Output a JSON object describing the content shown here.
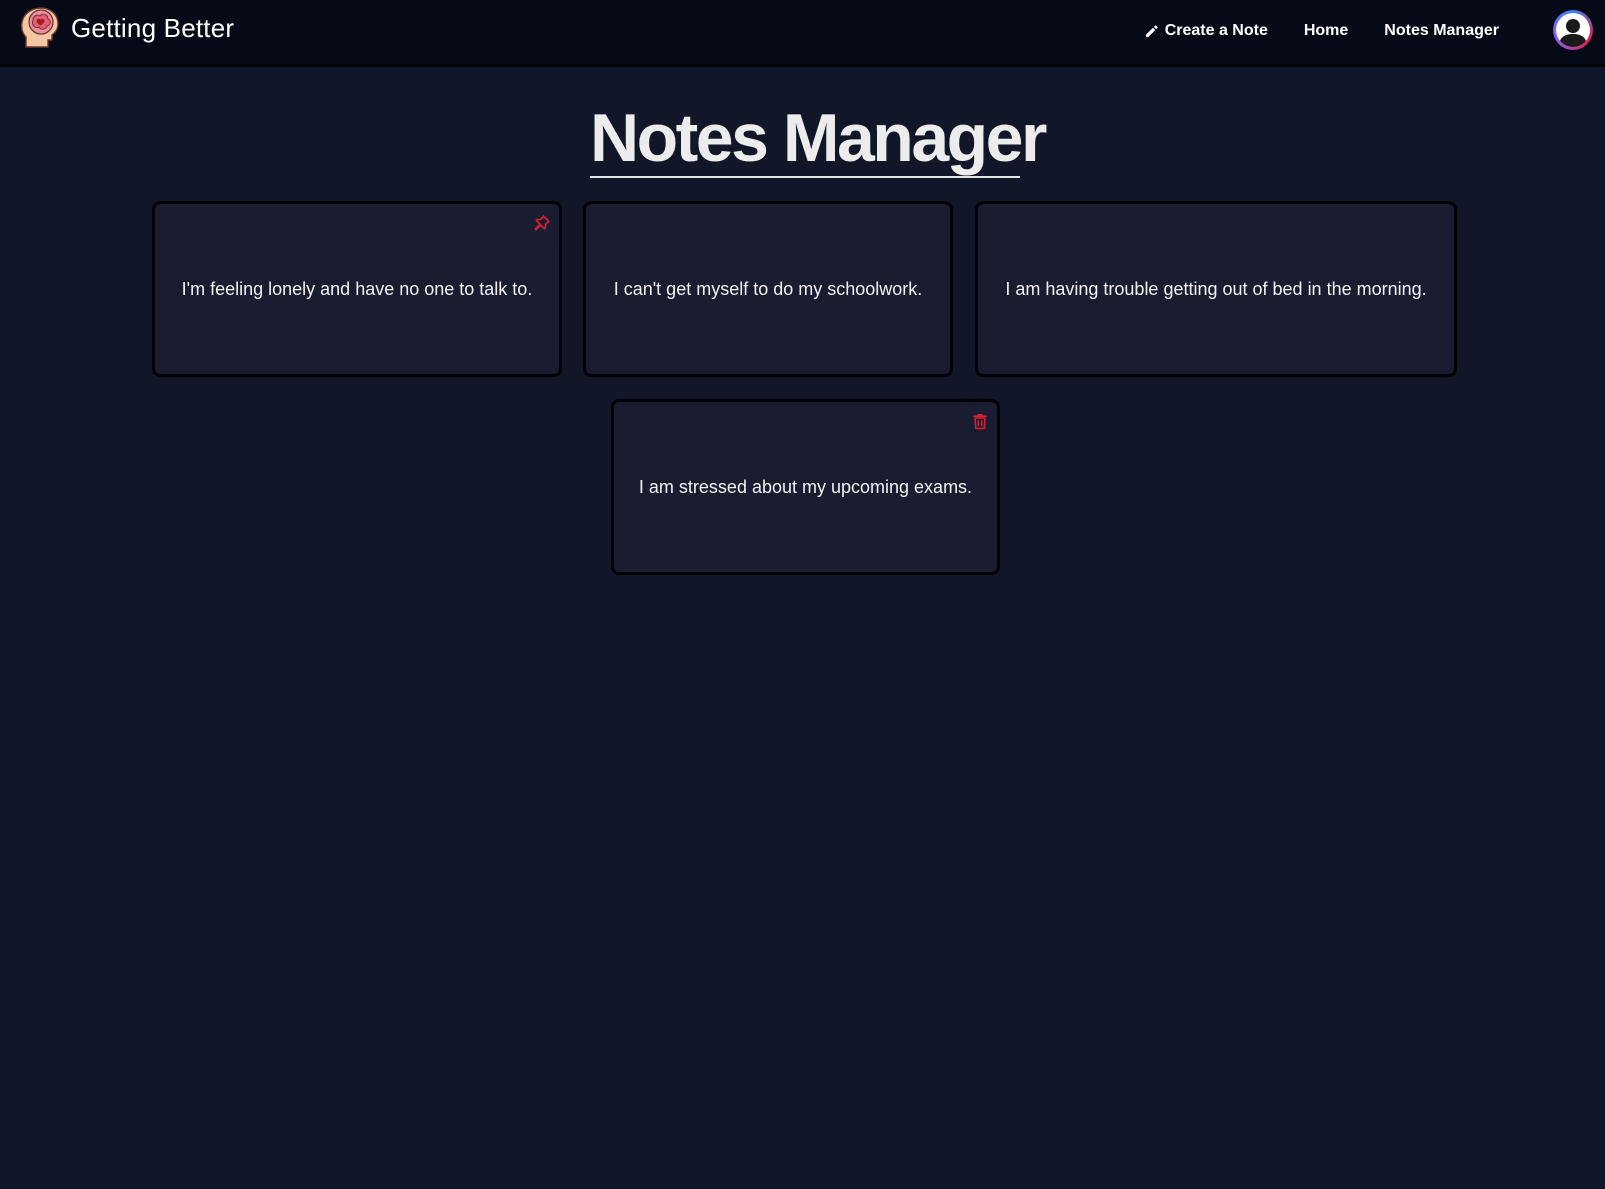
{
  "navbar": {
    "brand_title": "Getting Better",
    "links": [
      {
        "label": "Create a Note",
        "icon": "pencil-icon"
      },
      {
        "label": "Home"
      },
      {
        "label": "Notes Manager"
      }
    ],
    "avatar_icon": "user-avatar-icon"
  },
  "main": {
    "title": "Notes Manager",
    "notes": [
      {
        "text": "I'm feeling lonely and have no one to talk to.",
        "icon": "pin-icon",
        "icon_color": "#e01e2f"
      },
      {
        "text": "I can't get myself to do my schoolwork."
      },
      {
        "text": "I am having trouble getting out of bed in the morning."
      },
      {
        "text": "I am stressed about my upcoming exams.",
        "icon": "trash-icon",
        "icon_color": "#e01e2f"
      }
    ]
  },
  "colors": {
    "background": "#111729",
    "navbar": "#060a17",
    "card": "#1a1c30",
    "accent_red": "#e01e2f"
  }
}
